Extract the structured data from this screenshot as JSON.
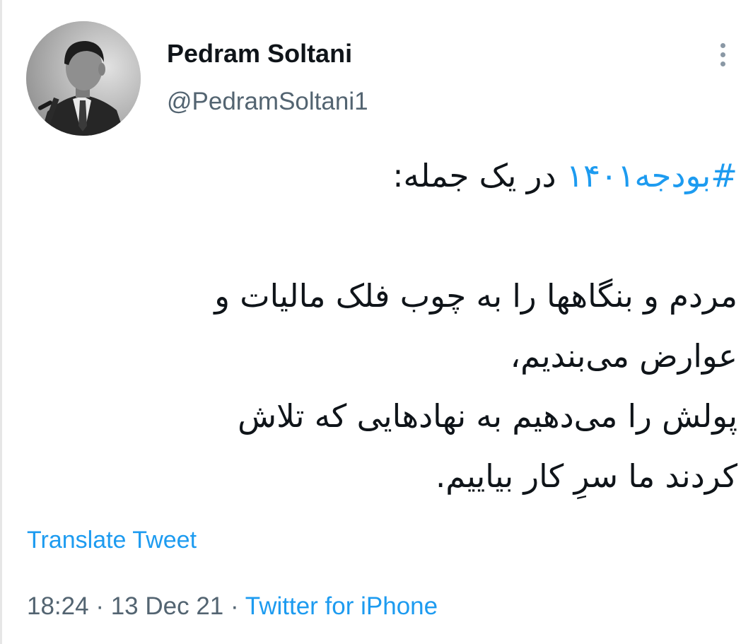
{
  "author": {
    "display_name": "Pedram Soltani",
    "handle": "@PedramSoltani1"
  },
  "tweet": {
    "hashtag": "#بودجه۱۴۰۱",
    "headline_rest": " در یک جمله:",
    "line1": "مردم و بنگاهها را به چوب فلک مالیات و",
    "line2": "عوارض می‌بندیم،",
    "line3": "پولش را می‌دهیم به نهادهایی که تلاش",
    "line4": "کردند ما سرِ کار بیاییم."
  },
  "translate_label": "Translate Tweet",
  "meta": {
    "time": "18:24",
    "separator": "·",
    "date": "13 Dec 21",
    "source": "Twitter for iPhone"
  },
  "icons": {
    "more": "more-vertical-icon"
  },
  "colors": {
    "link": "#1d9bf0",
    "secondary_text": "#536471",
    "primary_text": "#0f1419"
  }
}
